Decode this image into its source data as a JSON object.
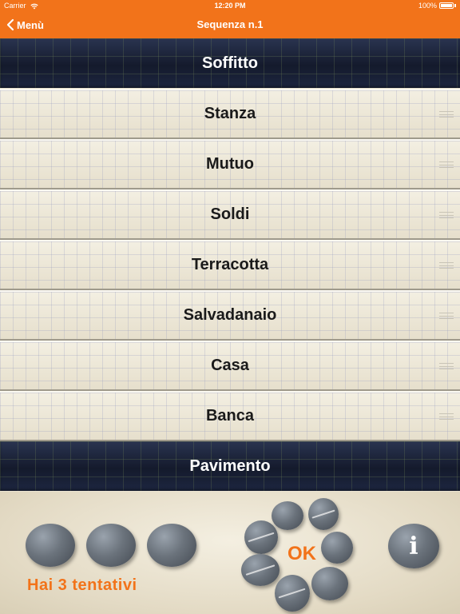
{
  "status": {
    "carrier": "Carrier",
    "time": "12:20 PM",
    "battery": "100%"
  },
  "nav": {
    "back_label": "Menù",
    "title": "Sequenza n.1"
  },
  "top_anchor": "Soffitto",
  "bottom_anchor": "Pavimento",
  "items": [
    {
      "label": "Stanza"
    },
    {
      "label": "Mutuo"
    },
    {
      "label": "Soldi"
    },
    {
      "label": "Terracotta"
    },
    {
      "label": "Salvadanaio"
    },
    {
      "label": "Casa"
    },
    {
      "label": "Banca"
    }
  ],
  "footer": {
    "attempts_label": "Hai 3 tentativi",
    "attempts_remaining": 3,
    "ok_label": "OK",
    "info_label": "i"
  },
  "colors": {
    "accent": "#f2731a",
    "anchor_bar": "#1b2338"
  }
}
